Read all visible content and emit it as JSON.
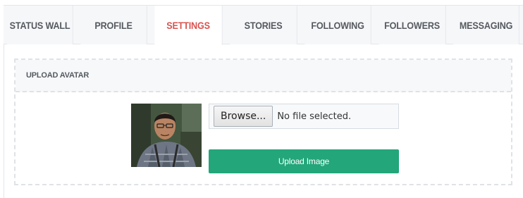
{
  "tabs": [
    {
      "label": "STATUS WALL",
      "active": false
    },
    {
      "label": "PROFILE",
      "active": false
    },
    {
      "label": "SETTINGS",
      "active": true
    },
    {
      "label": "STORIES",
      "active": false
    },
    {
      "label": "FOLLOWING",
      "active": false
    },
    {
      "label": "FOLLOWERS",
      "active": false
    },
    {
      "label": "MESSAGING",
      "active": false
    }
  ],
  "upload": {
    "heading": "UPLOAD AVATAR",
    "browse_label": "Browse...",
    "file_status": "No file selected.",
    "submit_label": "Upload Image"
  },
  "colors": {
    "active_tab": "#d9534f",
    "upload_button": "#23a67a"
  }
}
